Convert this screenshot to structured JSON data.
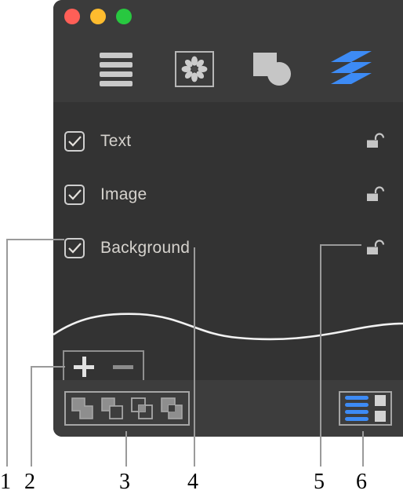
{
  "window": {
    "traffic_lights": [
      {
        "name": "close",
        "color": "#ff5f57"
      },
      {
        "name": "minimize",
        "color": "#febc2e"
      },
      {
        "name": "maximize",
        "color": "#28c840"
      }
    ],
    "toolbar": [
      {
        "id": "list",
        "icon": "list-bars-icon",
        "label": "List",
        "selected": false
      },
      {
        "id": "image",
        "icon": "image-flower-icon",
        "label": "Image",
        "selected": true
      },
      {
        "id": "shapes",
        "icon": "shapes-icon",
        "label": "Shapes",
        "selected": false
      },
      {
        "id": "layers",
        "icon": "layers-stack-icon",
        "label": "Layers",
        "selected": true
      }
    ]
  },
  "layers": {
    "rows": [
      {
        "name": "Text",
        "visible": true,
        "locked": false,
        "lock_icon": "unlocked-padlock-icon",
        "check_icon": "checkmark-icon"
      },
      {
        "name": "Image",
        "visible": true,
        "locked": false,
        "lock_icon": "unlocked-padlock-icon",
        "check_icon": "checkmark-icon"
      },
      {
        "name": "Background",
        "visible": true,
        "locked": false,
        "lock_icon": "unlocked-padlock-icon",
        "check_icon": "checkmark-icon"
      }
    ]
  },
  "plus_minus": {
    "add_label": "+",
    "remove_label": "–",
    "add_icon": "plus-icon",
    "remove_icon": "minus-icon"
  },
  "bottom_bar": {
    "boolean_ops": [
      {
        "id": "union",
        "icon": "boolean-union-icon"
      },
      {
        "id": "subtract",
        "icon": "boolean-subtract-icon"
      },
      {
        "id": "intersect",
        "icon": "boolean-intersect-icon"
      },
      {
        "id": "exclude",
        "icon": "boolean-exclude-icon"
      }
    ],
    "view_toggle": {
      "list_icon": "list-view-icon",
      "grid_icon": "grid-view-icon",
      "active": "list"
    }
  },
  "annotations": {
    "callouts": [
      {
        "number": "1",
        "target": "layer-visibility-checkbox"
      },
      {
        "number": "2",
        "target": "add-remove-layer-buttons"
      },
      {
        "number": "3",
        "target": "boolean-operations-group"
      },
      {
        "number": "4",
        "target": "layer-name-label"
      },
      {
        "number": "5",
        "target": "layer-lock-toggle"
      },
      {
        "number": "6",
        "target": "view-mode-toggle"
      }
    ]
  },
  "colors": {
    "window_bg": "#333333",
    "titlebar_bg": "#3b3b3b",
    "bottombar_bg": "#3d3d3d",
    "accent_blue": "#3d8bf5",
    "text": "#d5d2cd",
    "leader_line": "#9a9a9a"
  }
}
